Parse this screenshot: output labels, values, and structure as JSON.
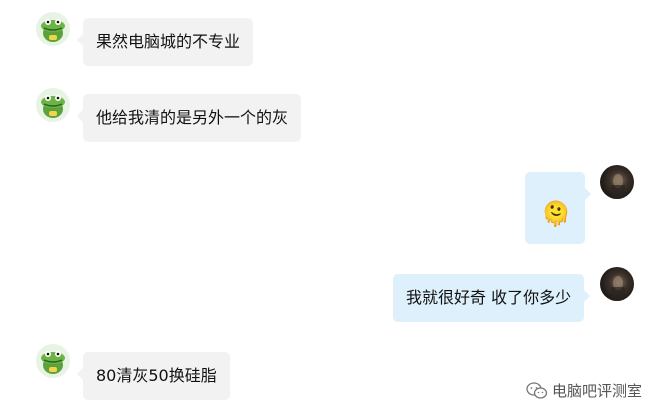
{
  "messages": [
    {
      "side": "in",
      "text": "果然电脑城的不专业"
    },
    {
      "side": "in",
      "text": "他给我清的是另外一个的灰"
    },
    {
      "side": "out",
      "emoji": "🫠"
    },
    {
      "side": "out",
      "text": "我就很好奇 收了你多少"
    },
    {
      "side": "in",
      "text": "80清灰50换硅脂"
    }
  ],
  "watermark": {
    "text": "电脑吧评测室",
    "icon": "wechat-icon"
  }
}
